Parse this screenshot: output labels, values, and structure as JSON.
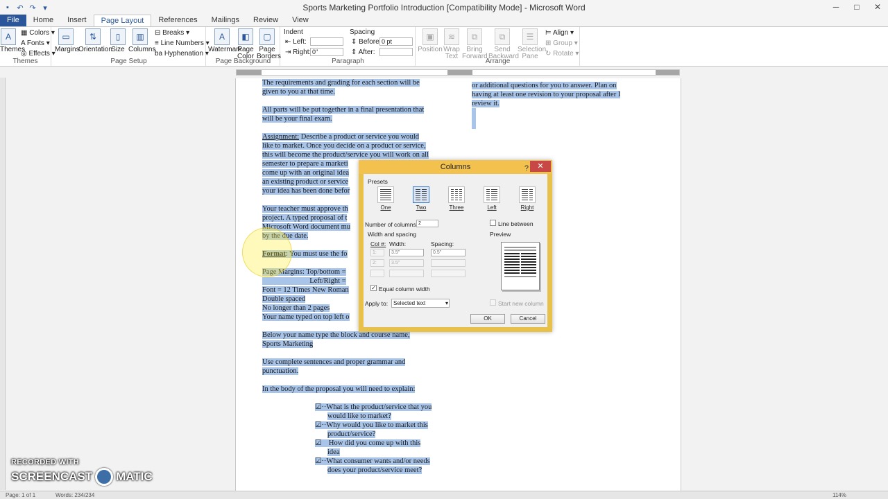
{
  "window": {
    "title": "Sports Marketing Portfolio Introduction [Compatibility Mode] - Microsoft Word",
    "qat_icons": [
      "save-icon",
      "undo-icon",
      "redo-icon",
      "customize-icon"
    ],
    "buttons": [
      "─",
      "□",
      "✕"
    ]
  },
  "ribbon": {
    "tabs": [
      "File",
      "Home",
      "Insert",
      "Page Layout",
      "References",
      "Mailings",
      "Review",
      "View"
    ],
    "active_tab": "Page Layout",
    "groups": {
      "themes": {
        "title": "Themes",
        "main": "Themes",
        "items": [
          "Colors",
          "Fonts",
          "Effects"
        ]
      },
      "page_setup": {
        "title": "Page Setup",
        "buttons": [
          "Margins",
          "Orientation",
          "Size",
          "Columns"
        ],
        "items": [
          "Breaks",
          "Line Numbers",
          "Hyphenation"
        ]
      },
      "page_background": {
        "title": "Page Background",
        "buttons": [
          "Watermark",
          "Page Color",
          "Page Borders"
        ]
      },
      "paragraph": {
        "title": "Paragraph",
        "indent_label": "Indent",
        "left_label": "Left:",
        "right_label": "Right:",
        "right_value": "0\"",
        "spacing_label": "Spacing",
        "before_label": "Before:",
        "before_value": "0 pt",
        "after_label": "After:"
      },
      "arrange": {
        "title": "Arrange",
        "buttons": [
          "Position",
          "Wrap Text",
          "Bring Forward",
          "Send Backward",
          "Selection Pane"
        ],
        "items": [
          "Align",
          "Group",
          "Rotate"
        ]
      }
    }
  },
  "document": {
    "left_column": [
      {
        "lines": [
          "The requirements and grading for each section will be",
          "given to you at that time."
        ]
      },
      {
        "lines": [
          "All parts will be put together in a final presentation that",
          "will be your final exam."
        ]
      },
      {
        "lead": "Assignment:",
        "lines": [
          " Describe a product or service you would",
          "like to market.  Once you decide on a product or service,",
          "this will become the product/service you will work on all",
          "semester to prepare a marketi",
          "come up with an original idea",
          "an existing product or service",
          "your idea has been done befor"
        ]
      },
      {
        "lines": [
          "Your teacher must approve th",
          "project.  A typed proposal of t",
          "Microsoft Word document mu",
          "by the due date."
        ]
      },
      {
        "lead": "Format",
        "lines": [
          ": You must use the fo"
        ]
      },
      {
        "lines": [
          "Page Margins:   Top/bottom =",
          "                          Left/Right =",
          "Font = 12 Times New Roman",
          "Double spaced",
          "No longer than 2 pages",
          "Your name typed on top left o"
        ]
      },
      {
        "lines": [
          "Below your name type the block and course name,",
          "Sports Marketing"
        ]
      },
      {
        "lines": [
          "Use complete sentences and proper grammar and",
          "punctuation."
        ]
      },
      {
        "lines": [
          "In the body of the proposal you will need to explain:"
        ]
      }
    ],
    "checklist": [
      [
        "What is the product/service that you",
        "would like to market?"
      ],
      [
        "Why would you like to market this",
        "product/service?"
      ],
      [
        "  How did you come up with this",
        "idea"
      ],
      [
        "What consumer wants and/or needs",
        "does your product/service meet?"
      ]
    ],
    "checklist_bullet": "☑",
    "right_column": [
      "or additional questions for you to answer.  Plan on",
      "having at least one revision to your proposal after I",
      "review it."
    ]
  },
  "dialog": {
    "title": "Columns",
    "help": "?",
    "close": "✕",
    "presets_label": "Presets",
    "presets": [
      "One",
      "Two",
      "Three",
      "Left",
      "Right"
    ],
    "active_preset": "Two",
    "num_columns_label": "Number of columns:",
    "num_columns_value": "2",
    "line_between_label": "Line between",
    "width_spacing_label": "Width and spacing",
    "col_header": "Col #:",
    "width_header": "Width:",
    "spacing_header": "Spacing:",
    "rows": [
      {
        "col": "1:",
        "width": "3.5\"",
        "spacing": "0.5\""
      },
      {
        "col": "2:",
        "width": "3.5\"",
        "spacing": ""
      }
    ],
    "equal_width_label": "Equal column width",
    "preview_label": "Preview",
    "apply_to_label": "Apply to:",
    "apply_to_value": "Selected text",
    "start_new_column_label": "Start new column",
    "ok_label": "OK",
    "cancel_label": "Cancel"
  },
  "statusbar": {
    "page": "Page: 1 of 1",
    "words": "Words: 234/234",
    "zoom": "114%"
  },
  "watermark": {
    "top": "RECORDED WITH",
    "left": "SCREENCAST",
    "right": "MATIC"
  }
}
